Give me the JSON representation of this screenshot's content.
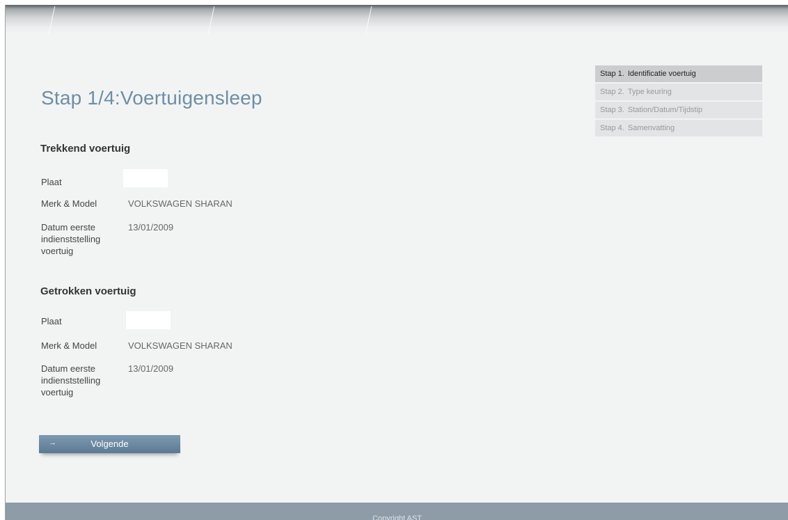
{
  "page_title": "Stap 1/4:Voertuigensleep",
  "steps": [
    {
      "num": "Stap 1.",
      "label": "Identificatie voertuig",
      "active": true
    },
    {
      "num": "Stap 2.",
      "label": "Type keuring",
      "active": false
    },
    {
      "num": "Stap 3.",
      "label": "Station/Datum/Tijdstip",
      "active": false
    },
    {
      "num": "Stap 4.",
      "label": "Samenvatting",
      "active": false
    }
  ],
  "towing": {
    "title": "Trekkend voertuig",
    "plate_label": "Plaat",
    "plate_value": "",
    "make_label": "Merk & Model",
    "make_value": "VOLKSWAGEN SHARAN",
    "date_label": "Datum eerste indienststelling voertuig",
    "date_value": "13/01/2009"
  },
  "towed": {
    "title": "Getrokken voertuig",
    "plate_label": "Plaat",
    "plate_value": "",
    "make_label": "Merk & Model",
    "make_value": "VOLKSWAGEN SHARAN",
    "date_label": "Datum eerste indienststelling voertuig",
    "date_value": "13/01/2009"
  },
  "next_button": {
    "arrow": "→",
    "label": "Volgende"
  },
  "footer": {
    "copyright": "Copyright AST"
  },
  "colors": {
    "accent": "#6e8ea6",
    "button": "#6a889f",
    "footer": "#8d9ca7"
  }
}
